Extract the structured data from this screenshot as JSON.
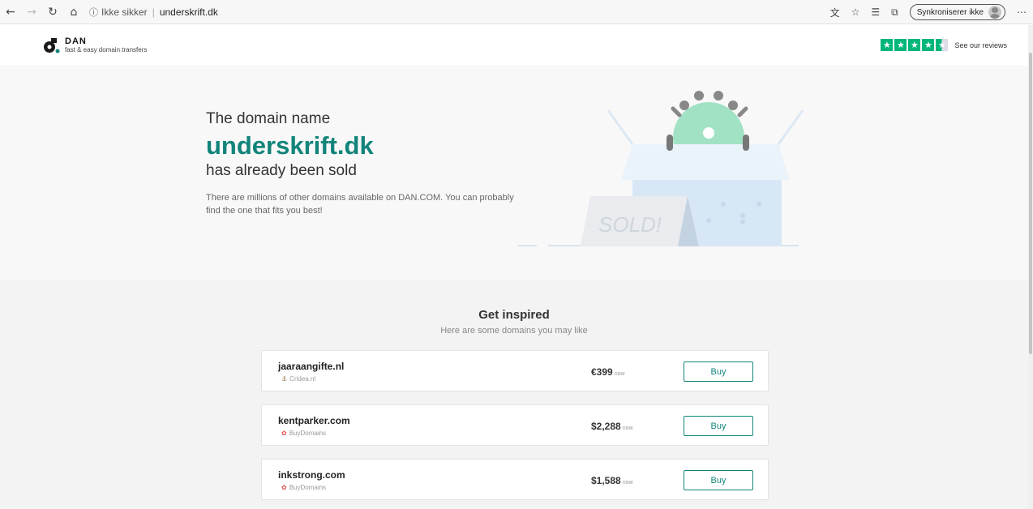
{
  "browser": {
    "not_secure": "Ikke sikker",
    "url": "underskrift.dk",
    "sync_label": "Synkroniserer ikke"
  },
  "header": {
    "brand": "DAN",
    "tagline": "fast & easy domain transfers",
    "reviews_link": "See our reviews",
    "rating_stars": 4.5,
    "star_color": "#00b67a"
  },
  "hero": {
    "line1": "The domain name",
    "domain": "underskrift.dk",
    "line3": "has already been sold",
    "description": "There are millions of other domains available on DAN.COM. You can probably find the one that fits you best!",
    "sign_text": "SOLD!",
    "accent_color": "#12847a"
  },
  "inspire": {
    "title": "Get inspired",
    "subtitle": "Here are some domains you may like",
    "items": [
      {
        "name": "jaaraangifte.nl",
        "seller": "Cridea.nl",
        "seller_icon": "ship-icon",
        "price": "€399",
        "price_suffix": "now",
        "buy_label": "Buy"
      },
      {
        "name": "kentparker.com",
        "seller": "BuyDomains",
        "seller_icon": "buydomains-icon",
        "price": "$2,288",
        "price_suffix": "now",
        "buy_label": "Buy"
      },
      {
        "name": "inkstrong.com",
        "seller": "BuyDomains",
        "seller_icon": "buydomains-icon",
        "price": "$1,588",
        "price_suffix": "now",
        "buy_label": "Buy"
      }
    ]
  }
}
